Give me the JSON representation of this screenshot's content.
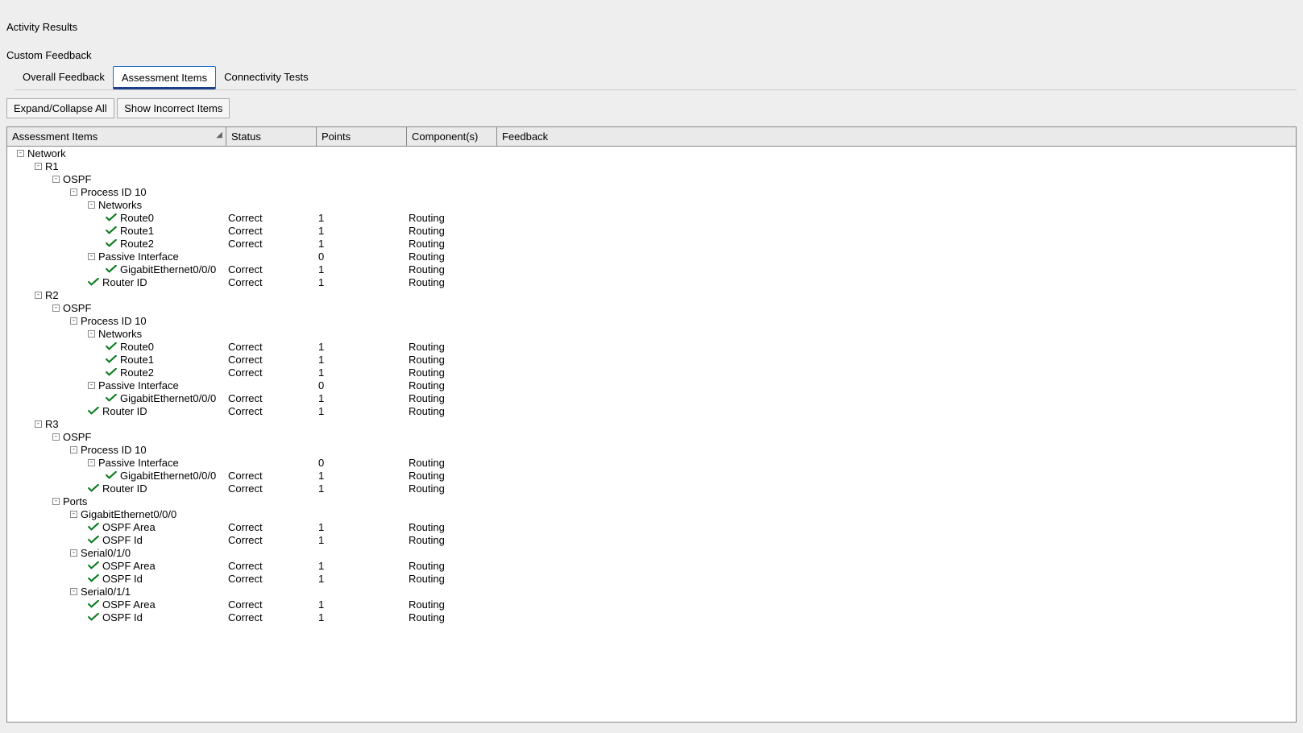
{
  "title": "Activity Results",
  "subtitle": "Custom Feedback",
  "tabs": {
    "overall": "Overall Feedback",
    "assessment": "Assessment Items",
    "connectivity": "Connectivity Tests"
  },
  "toolbar": {
    "expand_collapse": "Expand/Collapse All",
    "show_incorrect": "Show Incorrect Items"
  },
  "columns": {
    "items": "Assessment Items",
    "status": "Status",
    "points": "Points",
    "components": "Component(s)",
    "feedback": "Feedback"
  },
  "rows": [
    {
      "indent": 0,
      "expander": "-",
      "label": "Network"
    },
    {
      "indent": 1,
      "expander": "-",
      "label": "R1"
    },
    {
      "indent": 2,
      "expander": "-",
      "label": "OSPF"
    },
    {
      "indent": 3,
      "expander": "-",
      "label": "Process ID 10"
    },
    {
      "indent": 4,
      "expander": "-",
      "label": "Networks"
    },
    {
      "indent": 5,
      "check": true,
      "label": "Route0",
      "status": "Correct",
      "points": "1",
      "component": "Routing"
    },
    {
      "indent": 5,
      "check": true,
      "label": "Route1",
      "status": "Correct",
      "points": "1",
      "component": "Routing"
    },
    {
      "indent": 5,
      "check": true,
      "label": "Route2",
      "status": "Correct",
      "points": "1",
      "component": "Routing"
    },
    {
      "indent": 4,
      "expander": "-",
      "label": "Passive Interface",
      "points": "0",
      "component": "Routing"
    },
    {
      "indent": 5,
      "check": true,
      "label": "GigabitEthernet0/0/0",
      "status": "Correct",
      "points": "1",
      "component": "Routing"
    },
    {
      "indent": 4,
      "check": true,
      "label": "Router ID",
      "status": "Correct",
      "points": "1",
      "component": "Routing"
    },
    {
      "indent": 1,
      "expander": "-",
      "label": "R2"
    },
    {
      "indent": 2,
      "expander": "-",
      "label": "OSPF"
    },
    {
      "indent": 3,
      "expander": "-",
      "label": "Process ID 10"
    },
    {
      "indent": 4,
      "expander": "-",
      "label": "Networks"
    },
    {
      "indent": 5,
      "check": true,
      "label": "Route0",
      "status": "Correct",
      "points": "1",
      "component": "Routing"
    },
    {
      "indent": 5,
      "check": true,
      "label": "Route1",
      "status": "Correct",
      "points": "1",
      "component": "Routing"
    },
    {
      "indent": 5,
      "check": true,
      "label": "Route2",
      "status": "Correct",
      "points": "1",
      "component": "Routing"
    },
    {
      "indent": 4,
      "expander": "-",
      "label": "Passive Interface",
      "points": "0",
      "component": "Routing"
    },
    {
      "indent": 5,
      "check": true,
      "label": "GigabitEthernet0/0/0",
      "status": "Correct",
      "points": "1",
      "component": "Routing"
    },
    {
      "indent": 4,
      "check": true,
      "label": "Router ID",
      "status": "Correct",
      "points": "1",
      "component": "Routing"
    },
    {
      "indent": 1,
      "expander": "-",
      "label": "R3"
    },
    {
      "indent": 2,
      "expander": "-",
      "label": "OSPF"
    },
    {
      "indent": 3,
      "expander": "-",
      "label": "Process ID 10"
    },
    {
      "indent": 4,
      "expander": "-",
      "label": "Passive Interface",
      "points": "0",
      "component": "Routing"
    },
    {
      "indent": 5,
      "check": true,
      "label": "GigabitEthernet0/0/0",
      "status": "Correct",
      "points": "1",
      "component": "Routing"
    },
    {
      "indent": 4,
      "check": true,
      "label": "Router ID",
      "status": "Correct",
      "points": "1",
      "component": "Routing"
    },
    {
      "indent": 2,
      "expander": "-",
      "label": "Ports"
    },
    {
      "indent": 3,
      "expander": "-",
      "label": "GigabitEthernet0/0/0"
    },
    {
      "indent": 4,
      "check": true,
      "label": "OSPF Area",
      "status": "Correct",
      "points": "1",
      "component": "Routing"
    },
    {
      "indent": 4,
      "check": true,
      "label": "OSPF Id",
      "status": "Correct",
      "points": "1",
      "component": "Routing"
    },
    {
      "indent": 3,
      "expander": "-",
      "label": "Serial0/1/0"
    },
    {
      "indent": 4,
      "check": true,
      "label": "OSPF Area",
      "status": "Correct",
      "points": "1",
      "component": "Routing"
    },
    {
      "indent": 4,
      "check": true,
      "label": "OSPF Id",
      "status": "Correct",
      "points": "1",
      "component": "Routing"
    },
    {
      "indent": 3,
      "expander": "-",
      "label": "Serial0/1/1"
    },
    {
      "indent": 4,
      "check": true,
      "label": "OSPF Area",
      "status": "Correct",
      "points": "1",
      "component": "Routing"
    },
    {
      "indent": 4,
      "check": true,
      "label": "OSPF Id",
      "status": "Correct",
      "points": "1",
      "component": "Routing"
    }
  ]
}
